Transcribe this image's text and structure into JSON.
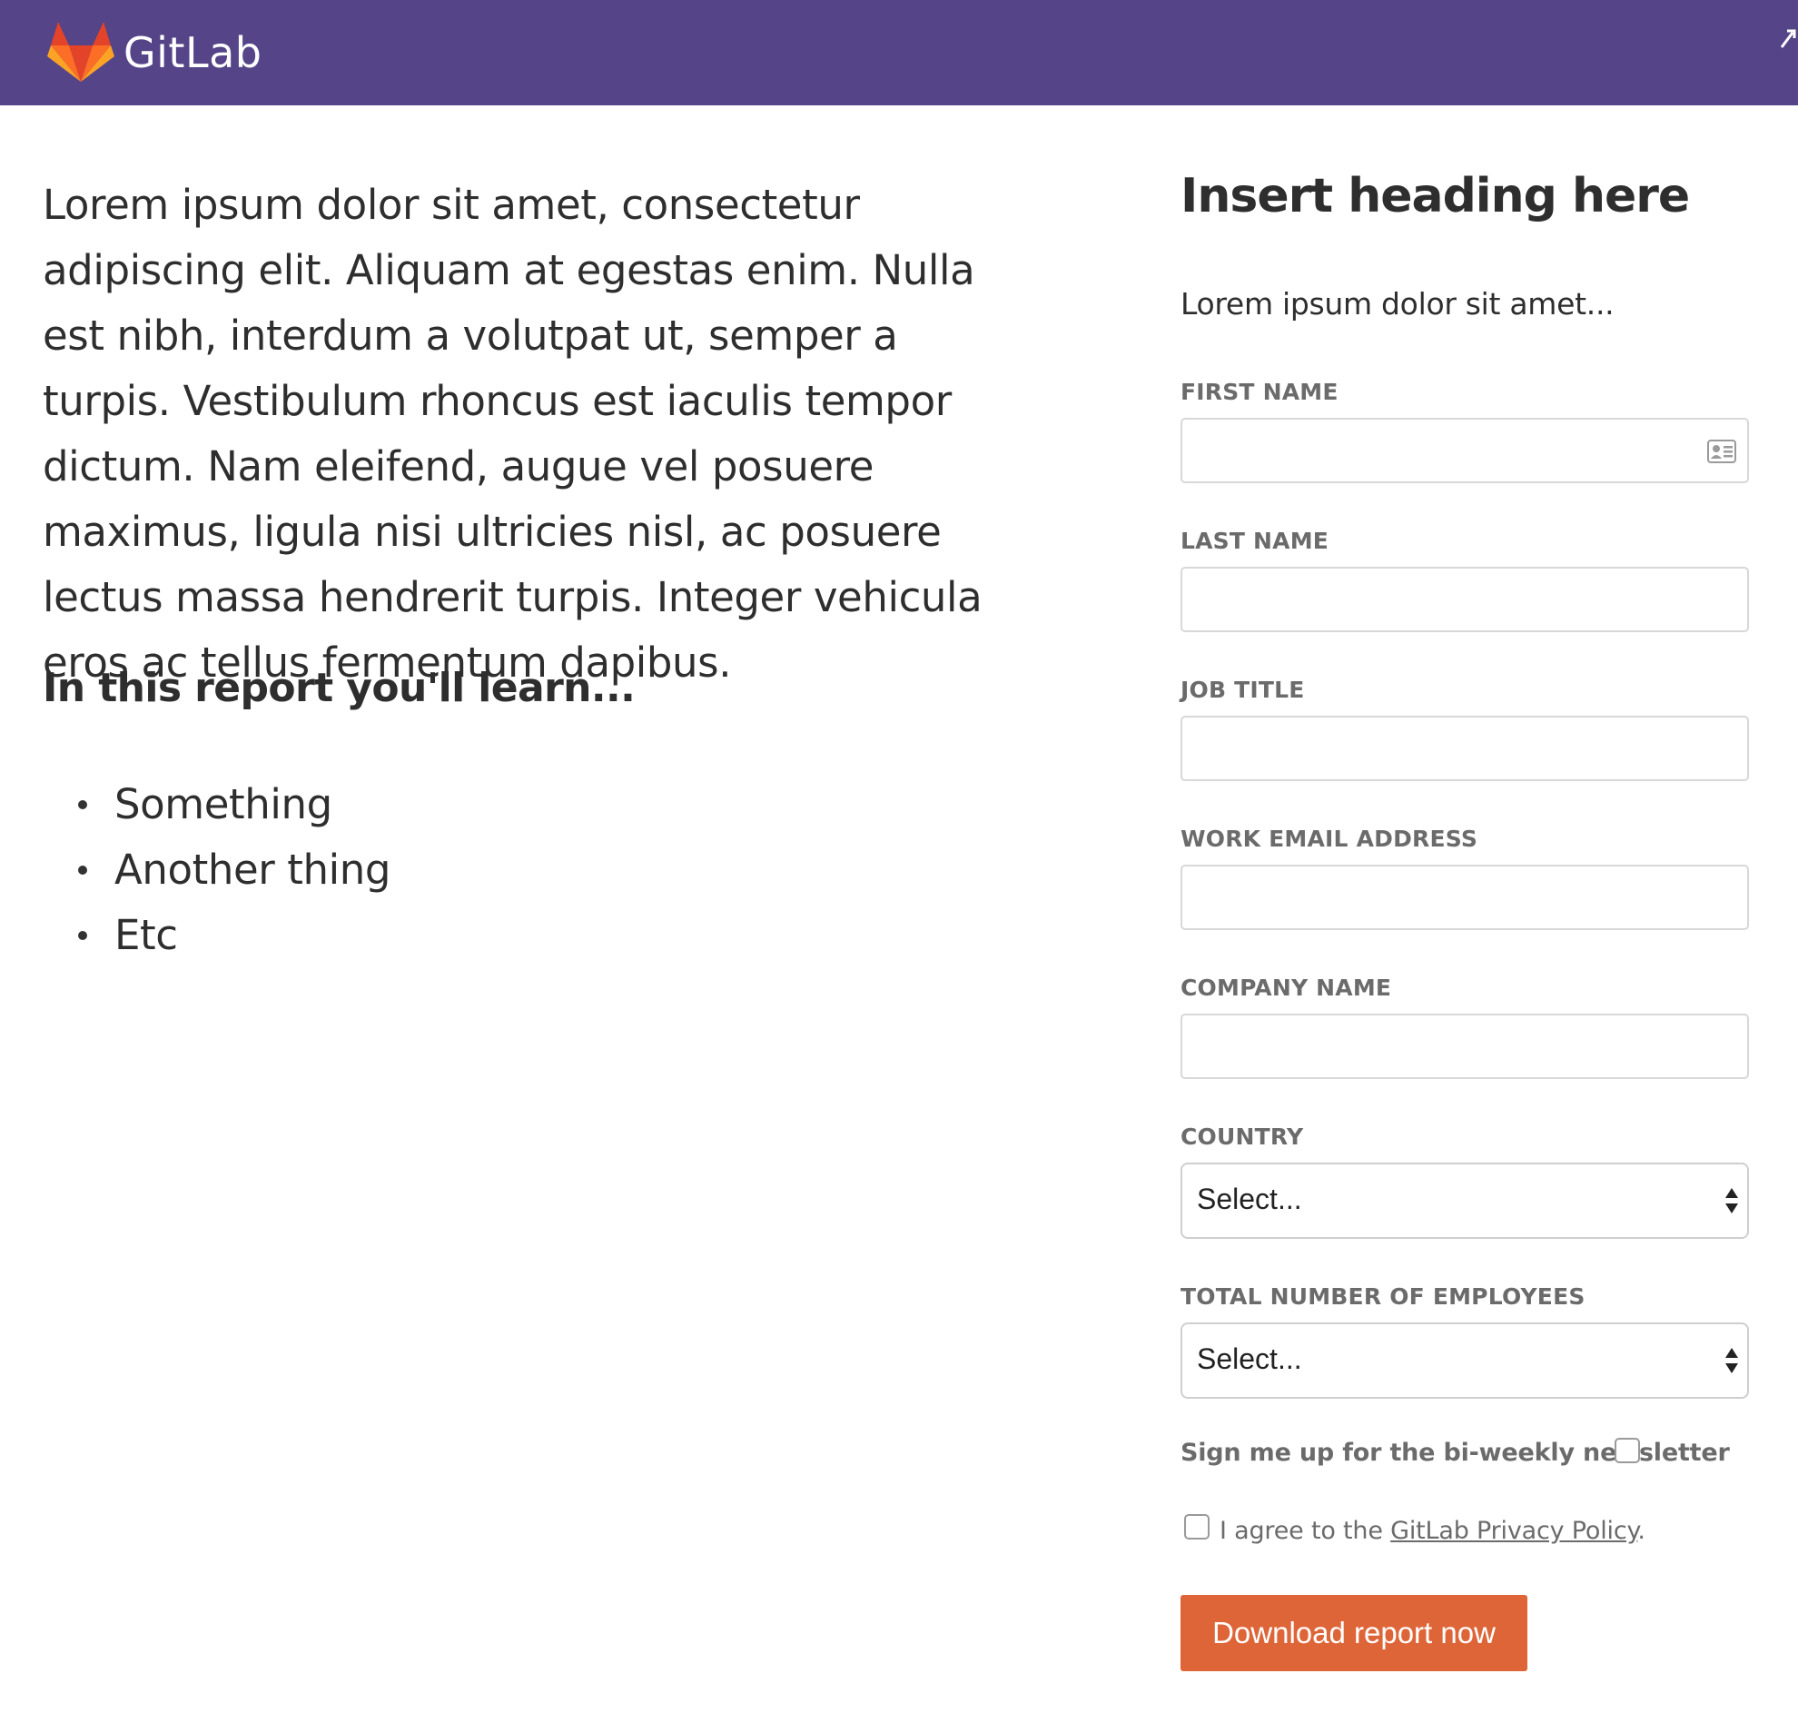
{
  "header": {
    "brand_name": "GitLab",
    "logo_icon": "gitlab-fox-logo",
    "background_color": "#554488"
  },
  "intro": {
    "paragraph": "Lorem ipsum dolor sit amet, consectetur adipiscing elit. Aliquam at egestas enim. Nulla est nibh, interdum a volutpat ut, semper a turpis. Vestibulum rhoncus est iaculis tempor dictum. Nam eleifend, augue vel posuere maximus, ligula nisi ultricies nisl, ac posuere lectus massa hendrerit turpis. Integer vehicula eros ac tellus fermentum dapibus.",
    "learn_heading": "In this report you'll learn...",
    "learn_items": [
      "Something",
      "Another thing",
      "Etc"
    ]
  },
  "form": {
    "heading": "Insert heading here",
    "subheading": "Lorem ipsum dolor sit amet...",
    "fields": {
      "first_name": {
        "label": "FIRST NAME",
        "value": ""
      },
      "last_name": {
        "label": "LAST NAME",
        "value": ""
      },
      "job_title": {
        "label": "JOB TITLE",
        "value": ""
      },
      "work_email": {
        "label": "WORK EMAIL ADDRESS",
        "value": ""
      },
      "company_name": {
        "label": "COMPANY NAME",
        "value": ""
      },
      "country": {
        "label": "COUNTRY",
        "selected": "Select..."
      },
      "employees": {
        "label": "TOTAL NUMBER OF EMPLOYEES",
        "selected": "Select..."
      }
    },
    "newsletter": {
      "label": "Sign me up for the bi-weekly newsletter",
      "checked": false
    },
    "privacy": {
      "prefix": "I agree to the ",
      "link_text": "GitLab Privacy Policy",
      "suffix": ".",
      "checked": false
    },
    "submit_label": "Download report now",
    "submit_color": "#de6537"
  }
}
